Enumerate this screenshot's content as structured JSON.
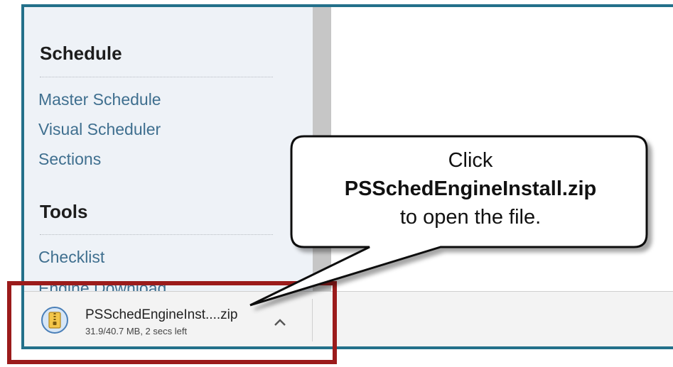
{
  "sidebar": {
    "sections": [
      {
        "title": "Schedule",
        "links": [
          "Master Schedule",
          "Visual Scheduler",
          "Sections"
        ]
      },
      {
        "title": "Tools",
        "links": [
          "Checklist"
        ]
      }
    ],
    "partial_link": "Engine Download"
  },
  "download": {
    "filename": "PSSchedEngineInst....zip",
    "status": "31.9/40.7 MB, 2 secs left",
    "icon": "zip-archive-icon"
  },
  "callout": {
    "line1": "Click",
    "line2": "PSSchedEngineInstall.zip",
    "line3": "to open the file."
  },
  "colors": {
    "frame": "#23708a",
    "highlight": "#9b1b1b",
    "link": "#3f6f8f",
    "sidebar_bg": "#eef2f7"
  }
}
